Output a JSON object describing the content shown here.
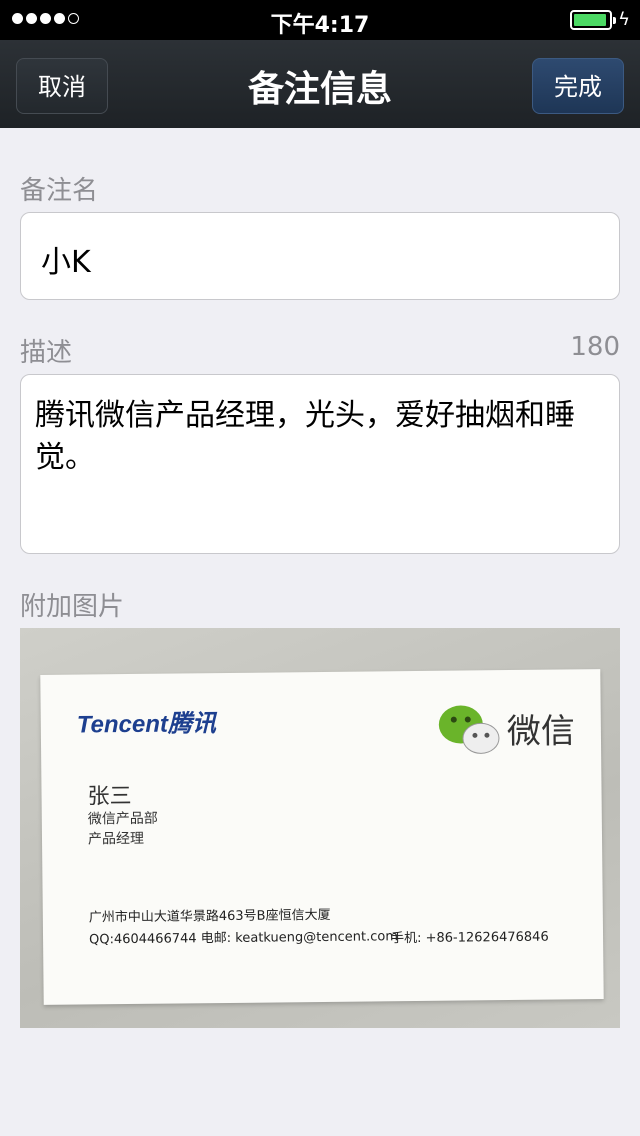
{
  "status_bar": {
    "time": "下午4:17"
  },
  "nav": {
    "cancel_label": "取消",
    "title": "备注信息",
    "done_label": "完成"
  },
  "remark_name": {
    "label": "备注名",
    "value": "小K"
  },
  "description": {
    "label": "描述",
    "remaining": "180",
    "value": "腾讯微信产品经理，光头，爱好抽烟和睡觉。"
  },
  "attached_image": {
    "label": "附加图片",
    "card": {
      "logo": "Tencent腾讯",
      "brand": "微信",
      "name": "张三",
      "department": "微信产品部",
      "title": "产品经理",
      "address": "广州市中山大道华景路463号B座恒信大厦",
      "contact": "QQ:4604466744 电邮: keatkueng@tencent.com",
      "phone": "手机: +86-12626476846"
    }
  },
  "colors": {
    "battery": "#4cd964",
    "done_button": "#1e3656",
    "background": "#efeff4"
  }
}
